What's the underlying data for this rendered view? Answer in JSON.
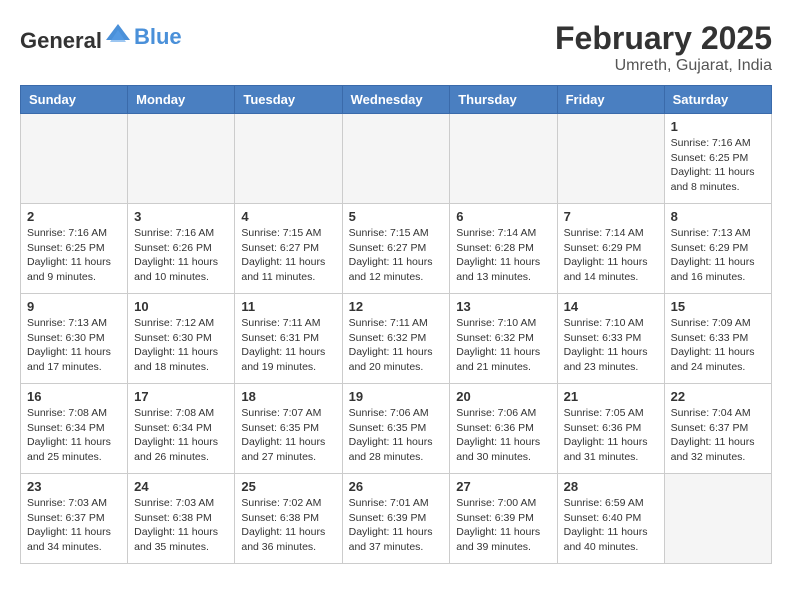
{
  "header": {
    "logo_general": "General",
    "logo_blue": "Blue",
    "month_year": "February 2025",
    "location": "Umreth, Gujarat, India"
  },
  "days_of_week": [
    "Sunday",
    "Monday",
    "Tuesday",
    "Wednesday",
    "Thursday",
    "Friday",
    "Saturday"
  ],
  "weeks": [
    [
      {
        "day": "",
        "info": ""
      },
      {
        "day": "",
        "info": ""
      },
      {
        "day": "",
        "info": ""
      },
      {
        "day": "",
        "info": ""
      },
      {
        "day": "",
        "info": ""
      },
      {
        "day": "",
        "info": ""
      },
      {
        "day": "1",
        "info": "Sunrise: 7:16 AM\nSunset: 6:25 PM\nDaylight: 11 hours and 8 minutes."
      }
    ],
    [
      {
        "day": "2",
        "info": "Sunrise: 7:16 AM\nSunset: 6:25 PM\nDaylight: 11 hours and 9 minutes."
      },
      {
        "day": "3",
        "info": "Sunrise: 7:16 AM\nSunset: 6:26 PM\nDaylight: 11 hours and 10 minutes."
      },
      {
        "day": "4",
        "info": "Sunrise: 7:15 AM\nSunset: 6:27 PM\nDaylight: 11 hours and 11 minutes."
      },
      {
        "day": "5",
        "info": "Sunrise: 7:15 AM\nSunset: 6:27 PM\nDaylight: 11 hours and 12 minutes."
      },
      {
        "day": "6",
        "info": "Sunrise: 7:14 AM\nSunset: 6:28 PM\nDaylight: 11 hours and 13 minutes."
      },
      {
        "day": "7",
        "info": "Sunrise: 7:14 AM\nSunset: 6:29 PM\nDaylight: 11 hours and 14 minutes."
      },
      {
        "day": "8",
        "info": "Sunrise: 7:13 AM\nSunset: 6:29 PM\nDaylight: 11 hours and 16 minutes."
      }
    ],
    [
      {
        "day": "9",
        "info": "Sunrise: 7:13 AM\nSunset: 6:30 PM\nDaylight: 11 hours and 17 minutes."
      },
      {
        "day": "10",
        "info": "Sunrise: 7:12 AM\nSunset: 6:30 PM\nDaylight: 11 hours and 18 minutes."
      },
      {
        "day": "11",
        "info": "Sunrise: 7:11 AM\nSunset: 6:31 PM\nDaylight: 11 hours and 19 minutes."
      },
      {
        "day": "12",
        "info": "Sunrise: 7:11 AM\nSunset: 6:32 PM\nDaylight: 11 hours and 20 minutes."
      },
      {
        "day": "13",
        "info": "Sunrise: 7:10 AM\nSunset: 6:32 PM\nDaylight: 11 hours and 21 minutes."
      },
      {
        "day": "14",
        "info": "Sunrise: 7:10 AM\nSunset: 6:33 PM\nDaylight: 11 hours and 23 minutes."
      },
      {
        "day": "15",
        "info": "Sunrise: 7:09 AM\nSunset: 6:33 PM\nDaylight: 11 hours and 24 minutes."
      }
    ],
    [
      {
        "day": "16",
        "info": "Sunrise: 7:08 AM\nSunset: 6:34 PM\nDaylight: 11 hours and 25 minutes."
      },
      {
        "day": "17",
        "info": "Sunrise: 7:08 AM\nSunset: 6:34 PM\nDaylight: 11 hours and 26 minutes."
      },
      {
        "day": "18",
        "info": "Sunrise: 7:07 AM\nSunset: 6:35 PM\nDaylight: 11 hours and 27 minutes."
      },
      {
        "day": "19",
        "info": "Sunrise: 7:06 AM\nSunset: 6:35 PM\nDaylight: 11 hours and 28 minutes."
      },
      {
        "day": "20",
        "info": "Sunrise: 7:06 AM\nSunset: 6:36 PM\nDaylight: 11 hours and 30 minutes."
      },
      {
        "day": "21",
        "info": "Sunrise: 7:05 AM\nSunset: 6:36 PM\nDaylight: 11 hours and 31 minutes."
      },
      {
        "day": "22",
        "info": "Sunrise: 7:04 AM\nSunset: 6:37 PM\nDaylight: 11 hours and 32 minutes."
      }
    ],
    [
      {
        "day": "23",
        "info": "Sunrise: 7:03 AM\nSunset: 6:37 PM\nDaylight: 11 hours and 34 minutes."
      },
      {
        "day": "24",
        "info": "Sunrise: 7:03 AM\nSunset: 6:38 PM\nDaylight: 11 hours and 35 minutes."
      },
      {
        "day": "25",
        "info": "Sunrise: 7:02 AM\nSunset: 6:38 PM\nDaylight: 11 hours and 36 minutes."
      },
      {
        "day": "26",
        "info": "Sunrise: 7:01 AM\nSunset: 6:39 PM\nDaylight: 11 hours and 37 minutes."
      },
      {
        "day": "27",
        "info": "Sunrise: 7:00 AM\nSunset: 6:39 PM\nDaylight: 11 hours and 39 minutes."
      },
      {
        "day": "28",
        "info": "Sunrise: 6:59 AM\nSunset: 6:40 PM\nDaylight: 11 hours and 40 minutes."
      },
      {
        "day": "",
        "info": ""
      }
    ]
  ]
}
